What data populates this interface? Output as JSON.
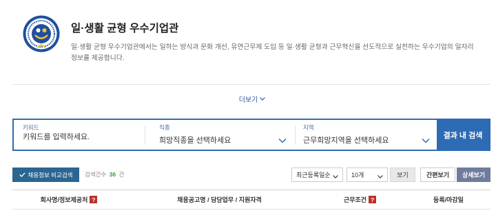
{
  "header": {
    "logo_icon": "award-badge-icon",
    "title": "일·생활 균형 우수기업관",
    "description_lines": [
      "일·생활 균형 우수기업관에서는 일하는 방식과 문화 개선, 유연근무제 도입 등 일·생활 균형과 근무혁신을 선도적으로 실천하는 우수기업의 일자리",
      "정보를 제공합니다."
    ]
  },
  "more": {
    "label": "더보기",
    "icon": "chevron-down-icon"
  },
  "search": {
    "keyword": {
      "label": "키워드",
      "placeholder": "키워드를 입력하세요."
    },
    "job": {
      "label": "직종",
      "value": "희망직종을 선택하세요"
    },
    "region": {
      "label": "지역",
      "value": "근무희망지역을 선택하세요"
    },
    "submit_label": "결과 내 검색"
  },
  "toolbar": {
    "compare_icon": "check-icon",
    "compare_label": "채용정보 비교검색",
    "count_label": "검색건수",
    "count": "36",
    "count_unit": "건",
    "sort": {
      "selected": "최근등록일순"
    },
    "page_size": {
      "selected": "10개"
    },
    "view_label": "보기",
    "simple_view_label": "간편보기",
    "detail_view_label": "상세보기"
  },
  "table": {
    "help_icon_text": "?",
    "columns": [
      {
        "label": "회사명/정보제공처",
        "help": true
      },
      {
        "label": "채용공고명 / 담당업무 / 지원자격",
        "help": false
      },
      {
        "label": "근무조건",
        "help": true
      },
      {
        "label": "등록/마감일",
        "help": false
      }
    ]
  },
  "colors": {
    "accent": "#2d6bb5",
    "compare": "#2b6592",
    "count": "#3a9a3a",
    "detail": "#6f7c9d",
    "help": "#b8322a"
  }
}
